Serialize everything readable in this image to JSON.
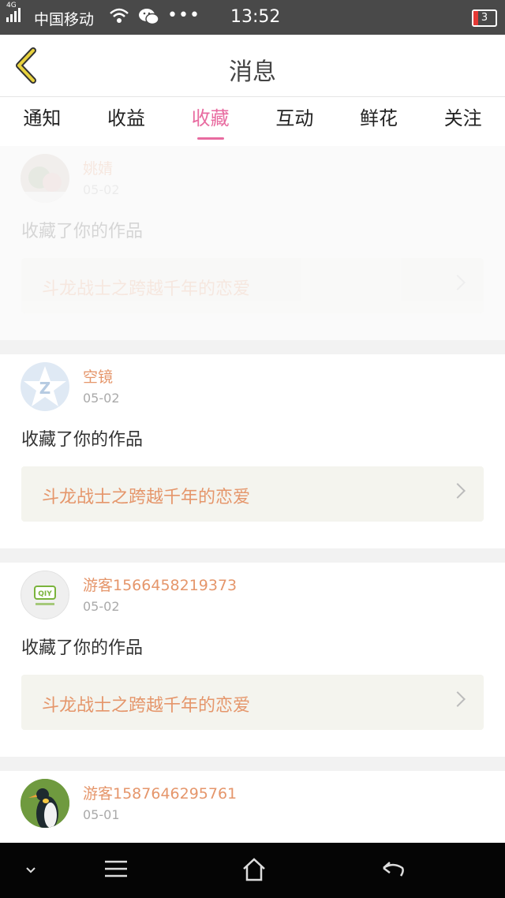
{
  "status_bar": {
    "network": "4G",
    "carrier": "中国移动",
    "dots": "•••",
    "time": "13:52",
    "battery": "3",
    "battery_color": "#e53935"
  },
  "header": {
    "title": "消息",
    "back_icon": "chevron-left-icon"
  },
  "tabs": [
    {
      "label": "通知",
      "active": false
    },
    {
      "label": "收益",
      "active": false
    },
    {
      "label": "收藏",
      "active": true
    },
    {
      "label": "互动",
      "active": false
    },
    {
      "label": "鲜花",
      "active": false
    },
    {
      "label": "关注",
      "active": false
    }
  ],
  "accent_color": "#e86ba0",
  "name_color": "#e5966b",
  "messages": [
    {
      "user": "姚婧",
      "date": "05-02",
      "action": "收藏了你的作品",
      "work": "斗龙战士之跨越千年的恋爱",
      "avatar": "photo-avatar"
    },
    {
      "user": "空镜",
      "date": "05-02",
      "action": "收藏了你的作品",
      "work": "斗龙战士之跨越千年的恋爱",
      "avatar": "qq-logo-avatar"
    },
    {
      "user": "游客1566458219373",
      "date": "05-02",
      "action": "收藏了你的作品",
      "work": "斗龙战士之跨越千年的恋爱",
      "avatar": "iqiyi-logo-avatar",
      "avatar_text": "QIY"
    },
    {
      "user": "游客1587646295761",
      "date": "05-01",
      "action": "",
      "work": "",
      "avatar": "penguin-avatar"
    }
  ],
  "navbar": {
    "icons": [
      "chevron-down-icon",
      "menu-icon",
      "home-icon",
      "back-arrow-icon"
    ]
  }
}
